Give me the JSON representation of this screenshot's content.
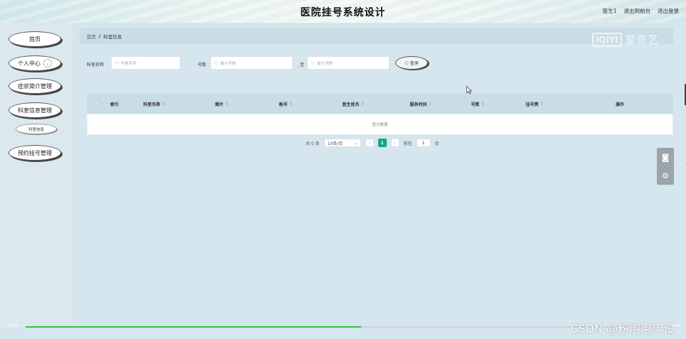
{
  "header": {
    "title": "医院挂号系统设计",
    "links": [
      "医生1",
      "退出到前台",
      "退出登录"
    ]
  },
  "sidebar": {
    "items": [
      {
        "label": "首页"
      },
      {
        "label": "个人中心",
        "expand": "⌄"
      },
      {
        "label": "症状简介管理"
      },
      {
        "label": "科室信息管理"
      },
      {
        "label": "科室信息",
        "sub": true
      },
      {
        "label": "预约挂号管理"
      }
    ]
  },
  "breadcrumb": {
    "home": "首页",
    "separator": "/",
    "current": "科室信息"
  },
  "filters": {
    "dept_label": "科室名称",
    "dept_placeholder": "科室名称",
    "count_label": "号数",
    "min_placeholder": "最小号数",
    "to_label": "至",
    "max_placeholder": "最大号数",
    "search_label": "查询"
  },
  "table": {
    "columns": [
      "索引",
      "科室名称",
      "图片",
      "账号",
      "医生姓名",
      "服务时间",
      "号数",
      "挂号费",
      "操作"
    ],
    "empty_text": "暂无数据"
  },
  "pagination": {
    "total": "共 0 条",
    "page_size": "10条/页",
    "current_page": "1",
    "goto_prefix": "前往",
    "goto_value": "1",
    "goto_suffix": "页"
  },
  "overlay": {
    "logo_box": "iQIYI",
    "logo_text": "爱奇艺",
    "watermark": "CSDN @粉泡泡毕设",
    "time_left": "03:28",
    "time_right": "09:00",
    "progress": 0.53,
    "progress_color": "#35c23f",
    "accent": "#17a38b"
  }
}
